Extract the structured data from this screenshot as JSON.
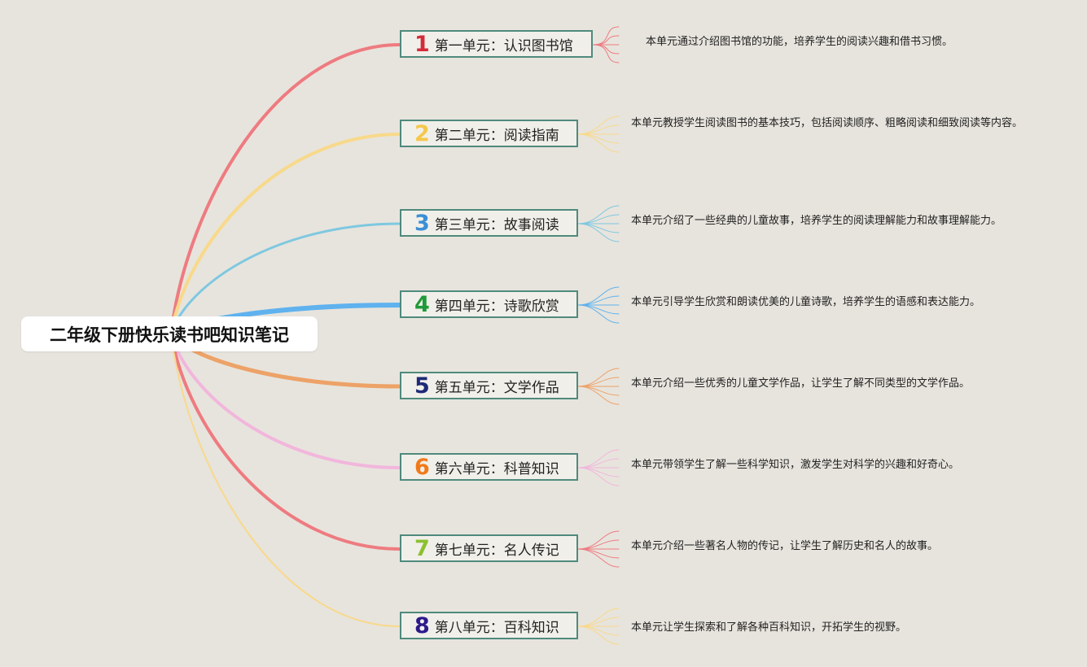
{
  "root": {
    "title": "二年级下册快乐读书吧知识笔记"
  },
  "units": [
    {
      "number": "1",
      "label": "第一单元：认识图书馆",
      "number_color": "#d42b3a",
      "branch_color": "#ee7b80",
      "desc": "本单元通过介绍图书馆的功能，培养学生的阅读兴趣和借书习惯。"
    },
    {
      "number": "2",
      "label": "第二单元：阅读指南",
      "number_color": "#f5c84c",
      "branch_color": "#f8d98a",
      "desc": "本单元教授学生阅读图书的基本技巧，包括阅读顺序、粗略阅读和细致阅读等内容。"
    },
    {
      "number": "3",
      "label": "第三单元：故事阅读",
      "number_color": "#3b8fd6",
      "branch_color": "#7ec8e0",
      "desc": "本单元介绍了一些经典的儿童故事，培养学生的阅读理解能力和故事理解能力。"
    },
    {
      "number": "4",
      "label": "第四单元：诗歌欣赏",
      "number_color": "#1f9a3a",
      "branch_color": "#5fb2ee",
      "desc": "本单元引导学生欣赏和朗读优美的儿童诗歌，培养学生的语感和表达能力。"
    },
    {
      "number": "5",
      "label": "第五单元：文学作品",
      "number_color": "#1e2a78",
      "branch_color": "#eda268",
      "desc": "本单元介绍一些优秀的儿童文学作品，让学生了解不同类型的文学作品。"
    },
    {
      "number": "6",
      "label": "第六单元：科普知识",
      "number_color": "#f07a1a",
      "branch_color": "#f2b6dc",
      "desc": "本单元带领学生了解一些科学知识，激发学生对科学的兴趣和好奇心。"
    },
    {
      "number": "7",
      "label": "第七单元：名人传记",
      "number_color": "#8dc030",
      "branch_color": "#ee7b80",
      "desc": "本单元介绍一些著名人物的传记，让学生了解历史和名人的故事。"
    },
    {
      "number": "8",
      "label": "第八单元：百科知识",
      "number_color": "#2c1a8c",
      "branch_color": "#f8d98a",
      "desc": "本单元让学生探索和了解各种百科知识，开拓学生的视野。"
    }
  ]
}
